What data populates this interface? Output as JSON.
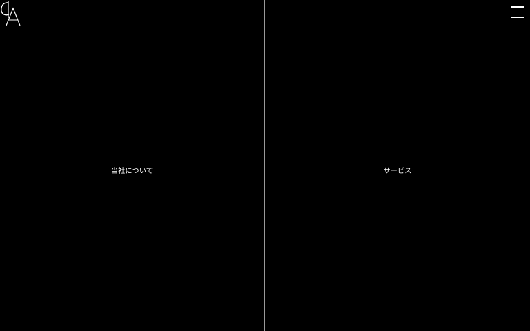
{
  "header": {
    "logo_name": "logo",
    "menu_icon": "hamburger-menu-icon"
  },
  "panels": [
    {
      "label": "当社について"
    },
    {
      "label": "サービス"
    }
  ],
  "colors": {
    "background": "#000000",
    "text": "#ffffff",
    "divider": "#9a9a9a"
  }
}
